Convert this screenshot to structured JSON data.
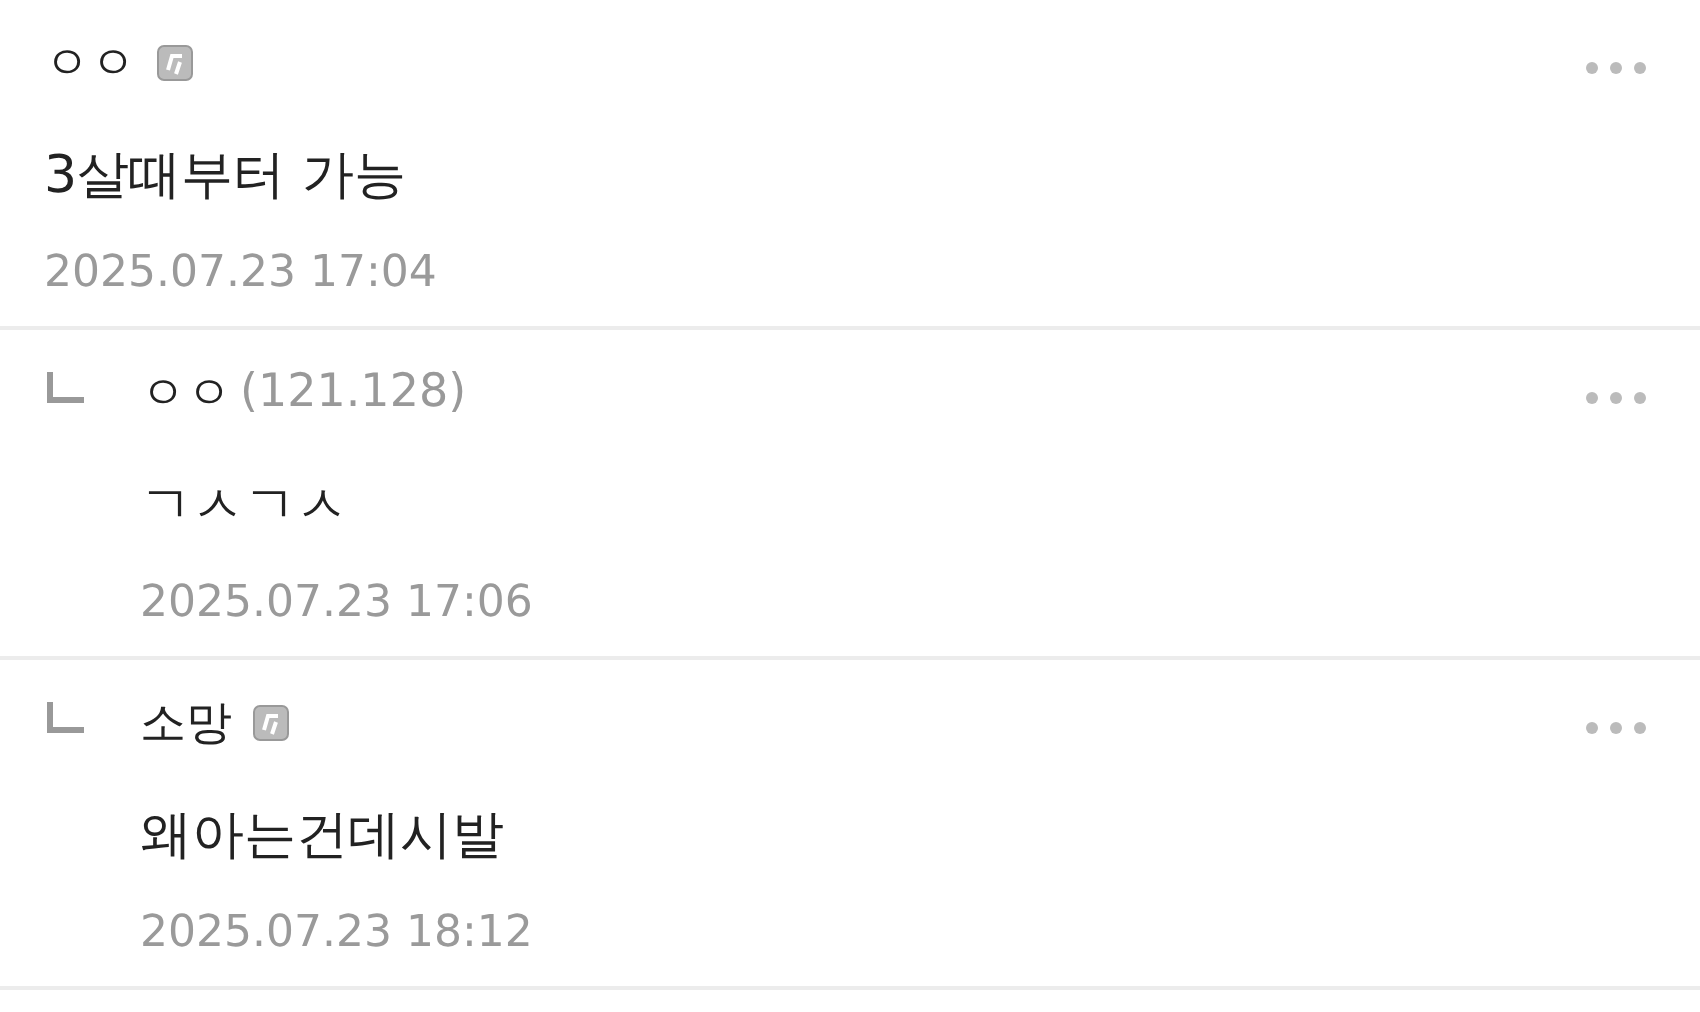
{
  "comments": [
    {
      "kind": "comment",
      "author": "ㅇㅇ",
      "member_badge": true,
      "body": "3살때부터 가능",
      "date": "2025.07.23 17:04"
    },
    {
      "kind": "reply",
      "author": "ㅇㅇ",
      "ip": "(121.128)",
      "member_badge": false,
      "body": "ㄱㅅㄱㅅ",
      "date": "2025.07.23 17:06"
    },
    {
      "kind": "reply",
      "author": "소망",
      "member_badge": true,
      "body": "왜아는건데시발",
      "date": "2025.07.23 18:12"
    }
  ]
}
